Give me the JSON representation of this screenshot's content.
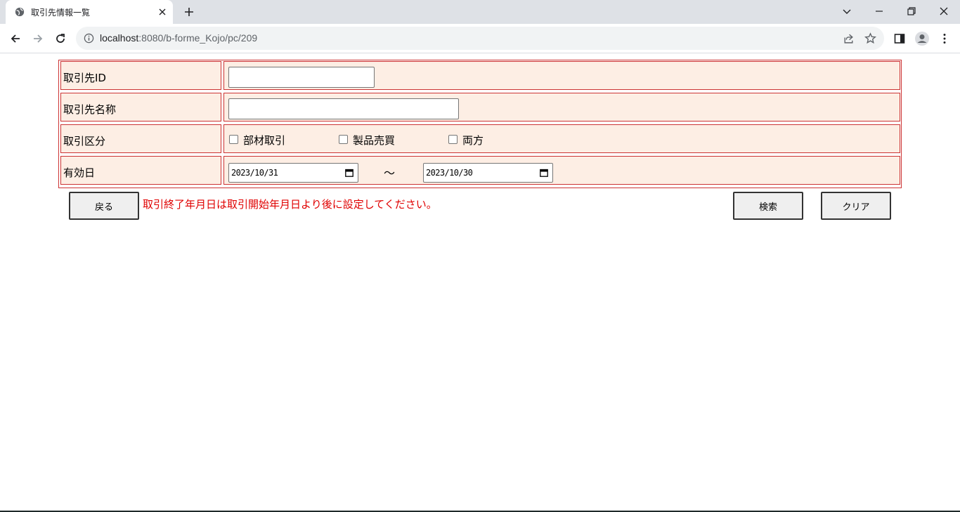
{
  "browser": {
    "tab_title": "取引先情報一覧",
    "url_host": "localhost",
    "url_rest": ":8080/b-forme_Kojo/pc/209"
  },
  "form": {
    "rows": [
      {
        "label": "取引先ID",
        "value": ""
      },
      {
        "label": "取引先名称",
        "value": ""
      },
      {
        "label": "取引区分",
        "options": [
          {
            "label": "部材取引",
            "checked": false
          },
          {
            "label": "製品売買",
            "checked": false
          },
          {
            "label": "両方",
            "checked": false
          }
        ]
      },
      {
        "label": "有効日",
        "date_from": "2023/10/31",
        "separator": "～",
        "date_to": "2023/10/30"
      }
    ]
  },
  "actions": {
    "back_label": "戻る",
    "search_label": "検索",
    "clear_label": "クリア"
  },
  "error_message": "取引終了年月日は取引開始年月日より後に設定してください。",
  "colors": {
    "table_bg": "#fdeee4",
    "table_border": "#cc3333",
    "error_text": "#e00000"
  }
}
